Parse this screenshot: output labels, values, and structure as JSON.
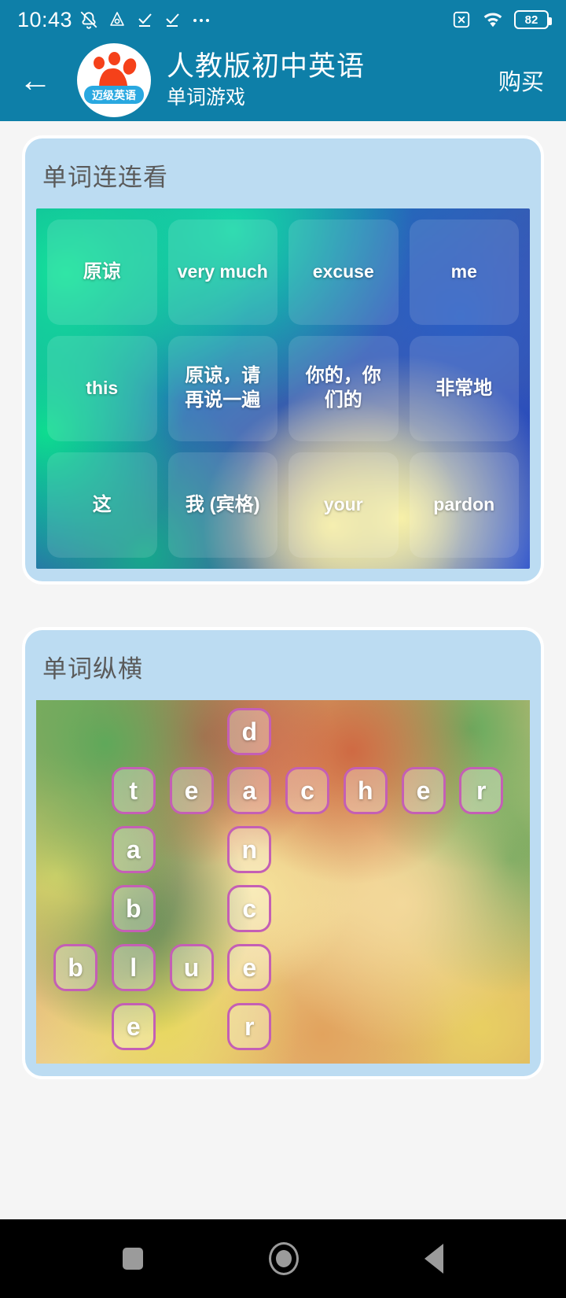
{
  "statusbar": {
    "time": "10:43",
    "left_icons": [
      "mute-bell-icon",
      "cloud-drop-icon",
      "check-underline-icon",
      "check-underline-icon",
      "more-dots-icon"
    ],
    "right_icons": [
      "no-sim-icon",
      "wifi-icon"
    ],
    "battery_level": "82"
  },
  "header": {
    "back_icon": "back-arrow-icon",
    "logo_badge": "迈级英语",
    "title": "人教版初中英语",
    "subtitle": "单词游戏",
    "buy_label": "购买",
    "accent_color": "#0e7fa8"
  },
  "cards": [
    {
      "title": "单词连连看"
    },
    {
      "title": "单词纵横"
    }
  ],
  "match_game": {
    "rows": [
      [
        "原谅",
        "very much",
        "excuse",
        "me"
      ],
      [
        "this",
        "原谅，请再说一遍",
        "你的，你们的",
        "非常地"
      ],
      [
        "这",
        "我 (宾格)",
        "your",
        "pardon"
      ]
    ]
  },
  "crossword": {
    "columns": 8,
    "rows": 6,
    "cells": [
      {
        "row": 1,
        "col": 4,
        "letter": "d"
      },
      {
        "row": 2,
        "col": 2,
        "letter": "t"
      },
      {
        "row": 2,
        "col": 3,
        "letter": "e"
      },
      {
        "row": 2,
        "col": 4,
        "letter": "a"
      },
      {
        "row": 2,
        "col": 5,
        "letter": "c"
      },
      {
        "row": 2,
        "col": 6,
        "letter": "h"
      },
      {
        "row": 2,
        "col": 7,
        "letter": "e"
      },
      {
        "row": 2,
        "col": 8,
        "letter": "r"
      },
      {
        "row": 3,
        "col": 2,
        "letter": "a"
      },
      {
        "row": 3,
        "col": 4,
        "letter": "n"
      },
      {
        "row": 4,
        "col": 2,
        "letter": "b"
      },
      {
        "row": 4,
        "col": 4,
        "letter": "c"
      },
      {
        "row": 5,
        "col": 1,
        "letter": "b"
      },
      {
        "row": 5,
        "col": 2,
        "letter": "l"
      },
      {
        "row": 5,
        "col": 3,
        "letter": "u"
      },
      {
        "row": 5,
        "col": 4,
        "letter": "e"
      },
      {
        "row": 6,
        "col": 2,
        "letter": "e"
      },
      {
        "row": 6,
        "col": 4,
        "letter": "r"
      }
    ],
    "cell_border_color": "#c45fb5"
  },
  "navbar": {
    "recents": "square-recents-icon",
    "home": "circle-home-icon",
    "back": "triangle-back-icon"
  }
}
